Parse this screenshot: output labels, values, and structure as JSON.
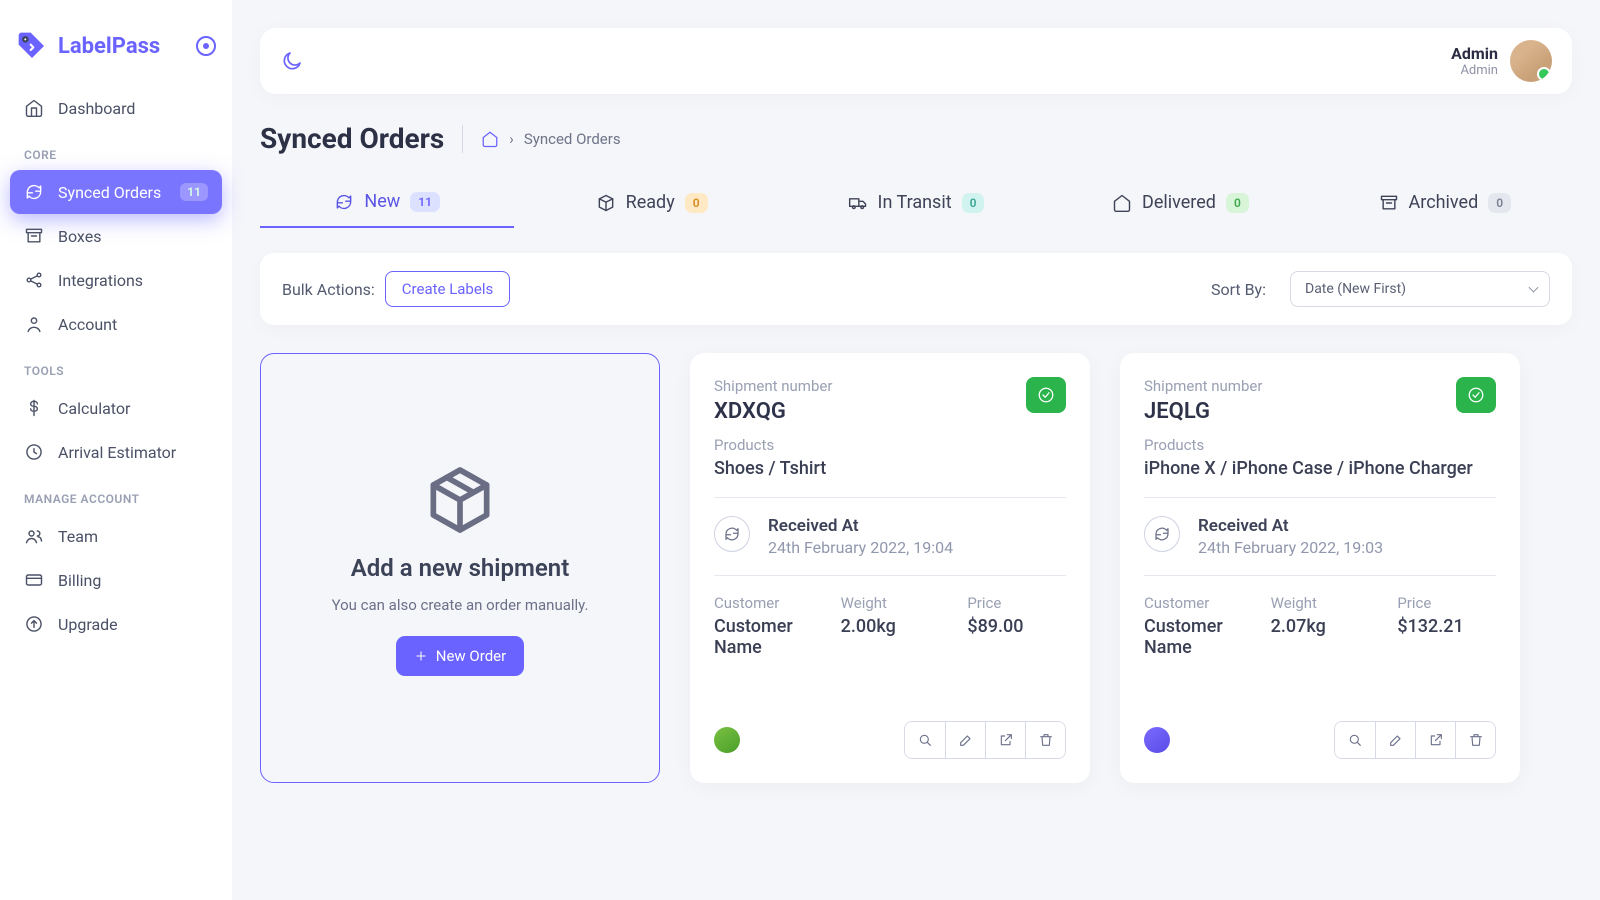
{
  "brand": "LabelPass",
  "sidebar": {
    "top_item": {
      "label": "Dashboard"
    },
    "sections": [
      {
        "title": "CORE",
        "items": [
          {
            "label": "Synced Orders",
            "count": "11",
            "active": true
          },
          {
            "label": "Boxes"
          },
          {
            "label": "Integrations"
          },
          {
            "label": "Account"
          }
        ]
      },
      {
        "title": "TOOLS",
        "items": [
          {
            "label": "Calculator"
          },
          {
            "label": "Arrival Estimator"
          }
        ]
      },
      {
        "title": "MANAGE ACCOUNT",
        "items": [
          {
            "label": "Team"
          },
          {
            "label": "Billing"
          },
          {
            "label": "Upgrade"
          }
        ]
      }
    ]
  },
  "user": {
    "name": "Admin",
    "role": "Admin"
  },
  "page": {
    "title": "Synced Orders",
    "breadcrumb": "Synced Orders"
  },
  "tabs": [
    {
      "label": "New",
      "count": "11",
      "badge": "blue",
      "active": true
    },
    {
      "label": "Ready",
      "count": "0",
      "badge": "yellow"
    },
    {
      "label": "In Transit",
      "count": "0",
      "badge": "teal"
    },
    {
      "label": "Delivered",
      "count": "0",
      "badge": "green"
    },
    {
      "label": "Archived",
      "count": "0",
      "badge": "gray"
    }
  ],
  "actions": {
    "bulk_label": "Bulk Actions:",
    "create_labels": "Create Labels",
    "sort_label": "Sort By:",
    "sort_value": "Date (New First)"
  },
  "new_card": {
    "title": "Add a new shipment",
    "subtitle": "You can also create an order manually.",
    "button": "New Order"
  },
  "labels": {
    "ship_num": "Shipment number",
    "products": "Products",
    "received": "Received At",
    "customer": "Customer",
    "weight": "Weight",
    "price": "Price"
  },
  "orders": [
    {
      "id": "XDXQG",
      "products": "Shoes / Tshirt",
      "received": "24th February 2022, 19:04",
      "customer": "Customer Name",
      "weight": "2.00kg",
      "price": "$89.00",
      "source": "green"
    },
    {
      "id": "JEQLG",
      "products": "iPhone X / iPhone Case / iPhone Charger",
      "received": "24th February 2022, 19:03",
      "customer": "Customer Name",
      "weight": "2.07kg",
      "price": "$132.21",
      "source": "purple"
    }
  ]
}
